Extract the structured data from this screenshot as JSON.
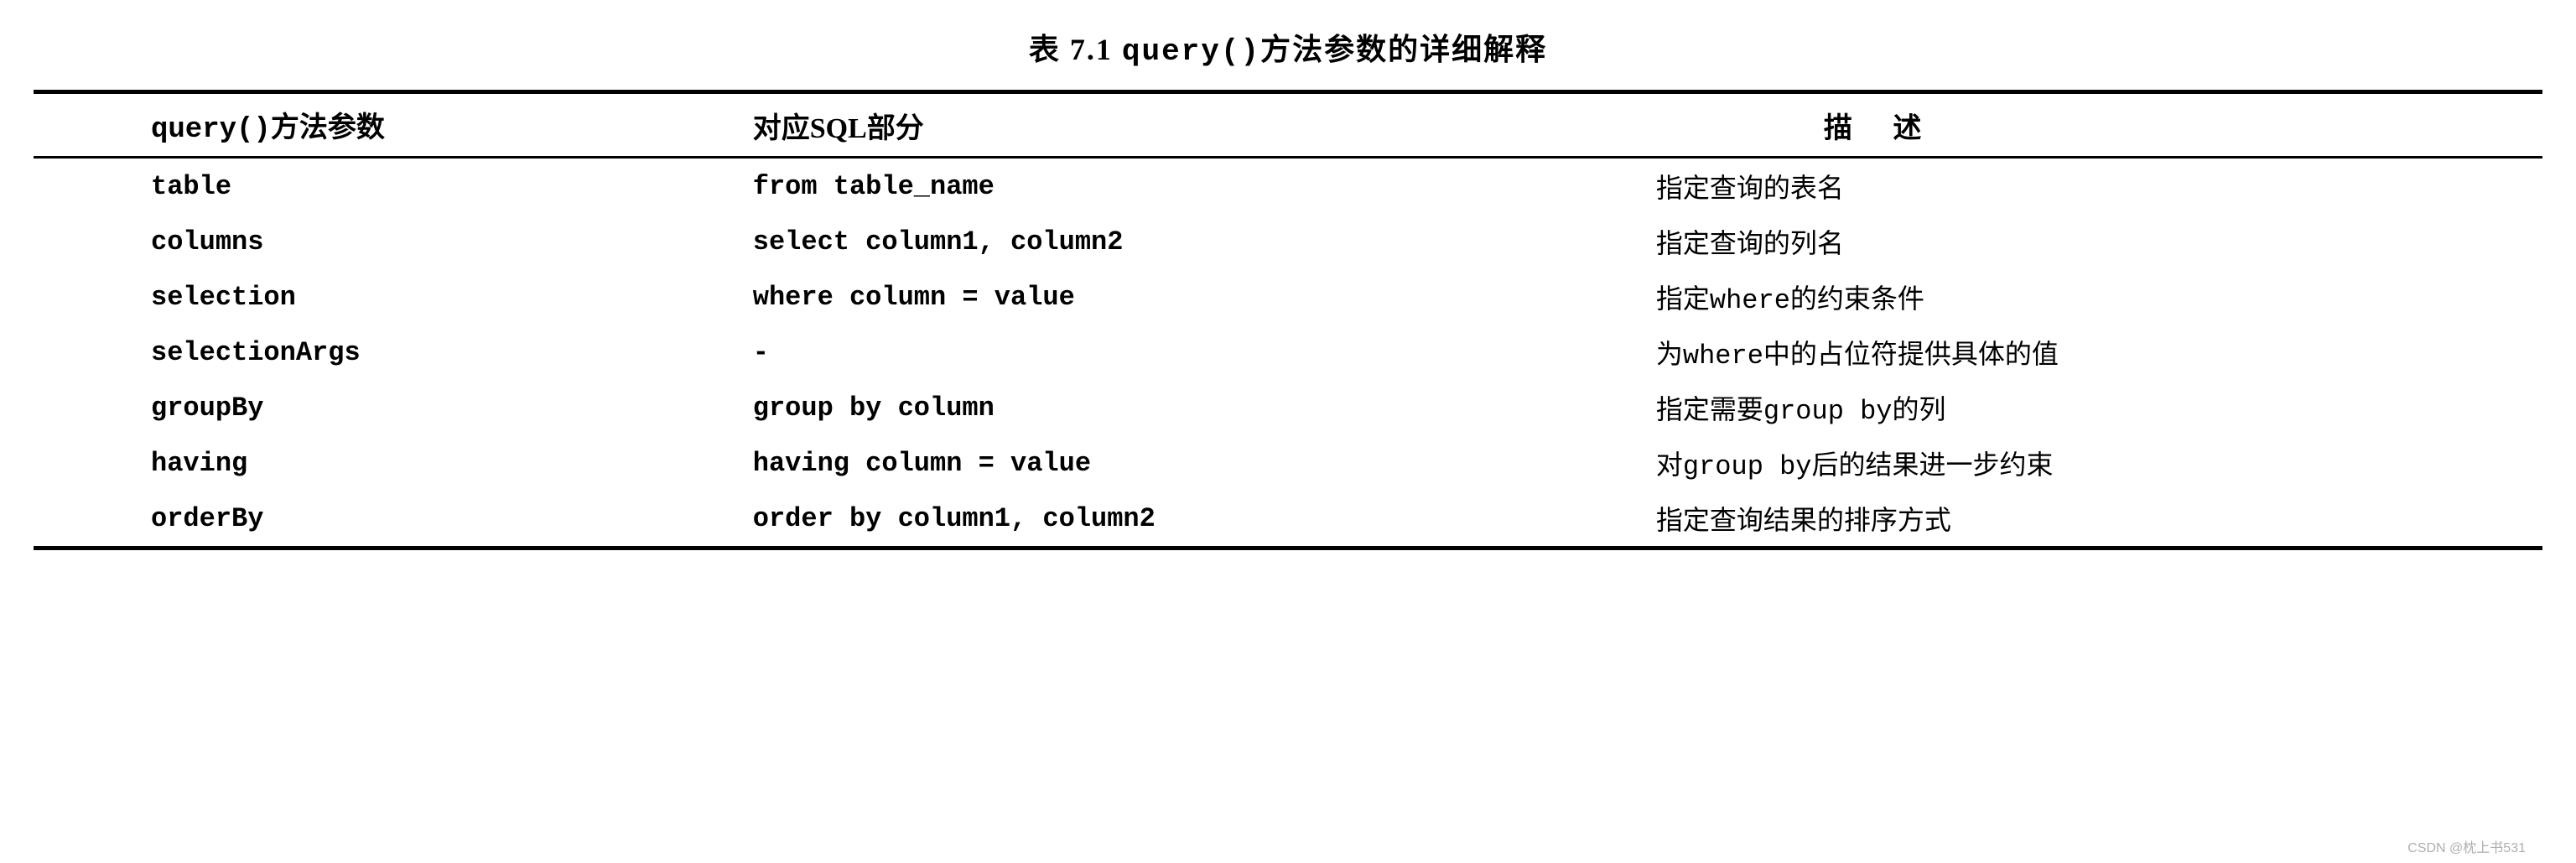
{
  "caption_prefix": "表 7.1  ",
  "caption_code": "query()",
  "caption_suffix": "方法参数的详细解释",
  "headers": {
    "param_code": "query()",
    "param_suffix": "方法参数",
    "sql": "对应SQL部分",
    "desc": "描 述"
  },
  "rows": [
    {
      "param": "table",
      "sql": "from table_name",
      "desc_pre": "指定查询的表名",
      "desc_mono": "",
      "desc_post": ""
    },
    {
      "param": "columns",
      "sql": "select column1, column2",
      "desc_pre": "指定查询的列名",
      "desc_mono": "",
      "desc_post": ""
    },
    {
      "param": "selection",
      "sql": "where column = value",
      "desc_pre": "指定",
      "desc_mono": "where",
      "desc_post": "的约束条件"
    },
    {
      "param": "selectionArgs",
      "sql": "-",
      "desc_pre": "为",
      "desc_mono": "where",
      "desc_post": "中的占位符提供具体的值"
    },
    {
      "param": "groupBy",
      "sql": "group by column",
      "desc_pre": "指定需要",
      "desc_mono": "group by",
      "desc_post": "的列"
    },
    {
      "param": "having",
      "sql": "having column = value",
      "desc_pre": "对",
      "desc_mono": "group by",
      "desc_post": "后的结果进一步约束"
    },
    {
      "param": "orderBy",
      "sql": "order by column1, column2",
      "desc_pre": "指定查询结果的排序方式",
      "desc_mono": "",
      "desc_post": ""
    }
  ],
  "watermark": "CSDN @枕上书531"
}
